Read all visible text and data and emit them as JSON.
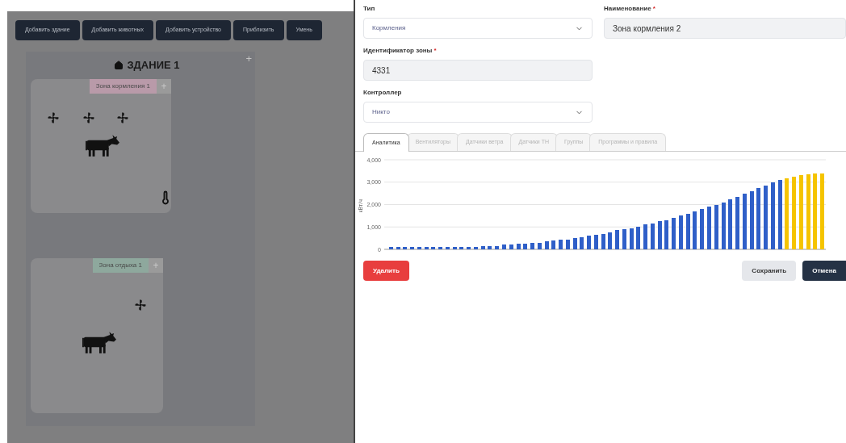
{
  "toolbar": [
    "Добавить здание",
    "Добавить животных",
    "Добавить устройство",
    "Приблизить",
    "Умень"
  ],
  "building": {
    "title": "ЗДАНИЕ 1",
    "add_label": "+",
    "zones": [
      {
        "label": "Зона кормления 1",
        "color": "#b99aa9",
        "add_label": "+",
        "items": [
          {
            "kind": "fan"
          },
          {
            "kind": "fan"
          },
          {
            "kind": "fan"
          },
          {
            "kind": "cow"
          },
          {
            "kind": "thermometer"
          }
        ]
      },
      {
        "label": "Зона отдыха 1",
        "color": "#8ea89d",
        "add_label": "+",
        "items": [
          {
            "kind": "fan"
          },
          {
            "kind": "cow"
          }
        ]
      }
    ]
  },
  "form": {
    "type": {
      "label": "Тип",
      "value": "Кормления"
    },
    "name": {
      "label": "Наименование",
      "required_mark": "*",
      "value": "Зона кормления 2"
    },
    "zone_id": {
      "label": "Идентификатор зоны",
      "required_mark": "*",
      "value": "4331"
    },
    "controller": {
      "label": "Контроллер",
      "value": "Никто"
    }
  },
  "tabs": [
    {
      "label": "Аналитика",
      "selected": true
    },
    {
      "label": "Вентиляторы",
      "selected": false
    },
    {
      "label": "Датчики ветра",
      "selected": false
    },
    {
      "label": "Датчики ТН",
      "selected": false
    },
    {
      "label": "Группы",
      "selected": false
    },
    {
      "label": "Программы и правила",
      "selected": false
    }
  ],
  "chart_data": {
    "type": "bar",
    "ylabel": "кВт/ч",
    "grid": true,
    "ylim": [
      0,
      4000
    ],
    "yticks": [
      {
        "value": 0,
        "label": "0"
      },
      {
        "value": 1000,
        "label": "1,000"
      },
      {
        "value": 2000,
        "label": "2,000"
      },
      {
        "value": 3000,
        "label": "3,000"
      },
      {
        "value": 4000,
        "label": "4,000"
      }
    ],
    "series": [
      {
        "color": "#2f5fc8",
        "values": [
          100,
          100,
          100,
          100,
          100,
          100,
          100,
          100,
          100,
          100,
          100,
          100,
          100,
          150,
          150,
          150,
          200,
          200,
          250,
          250,
          300,
          300,
          350,
          400,
          450,
          450,
          500,
          550,
          600,
          650,
          700,
          750,
          850,
          900,
          950,
          1000,
          1100,
          1150,
          1250,
          1300,
          1400,
          1500,
          1600,
          1700,
          1800,
          1900,
          2000,
          2100,
          2250,
          2350,
          2500,
          2600,
          2750,
          2850,
          3000,
          3100,
          null,
          null,
          null,
          null,
          null,
          null
        ]
      },
      {
        "color": "#f5c400",
        "values": [
          null,
          null,
          null,
          null,
          null,
          null,
          null,
          null,
          null,
          null,
          null,
          null,
          null,
          null,
          null,
          null,
          null,
          null,
          null,
          null,
          null,
          null,
          null,
          null,
          null,
          null,
          null,
          null,
          null,
          null,
          null,
          null,
          null,
          null,
          null,
          null,
          null,
          null,
          null,
          null,
          null,
          null,
          null,
          null,
          null,
          null,
          null,
          null,
          null,
          null,
          null,
          null,
          null,
          null,
          null,
          null,
          3180,
          3240,
          3300,
          3340,
          3370,
          3390
        ]
      }
    ]
  },
  "actions": {
    "delete": "Удалить",
    "save": "Сохранить",
    "cancel": "Отмена"
  }
}
